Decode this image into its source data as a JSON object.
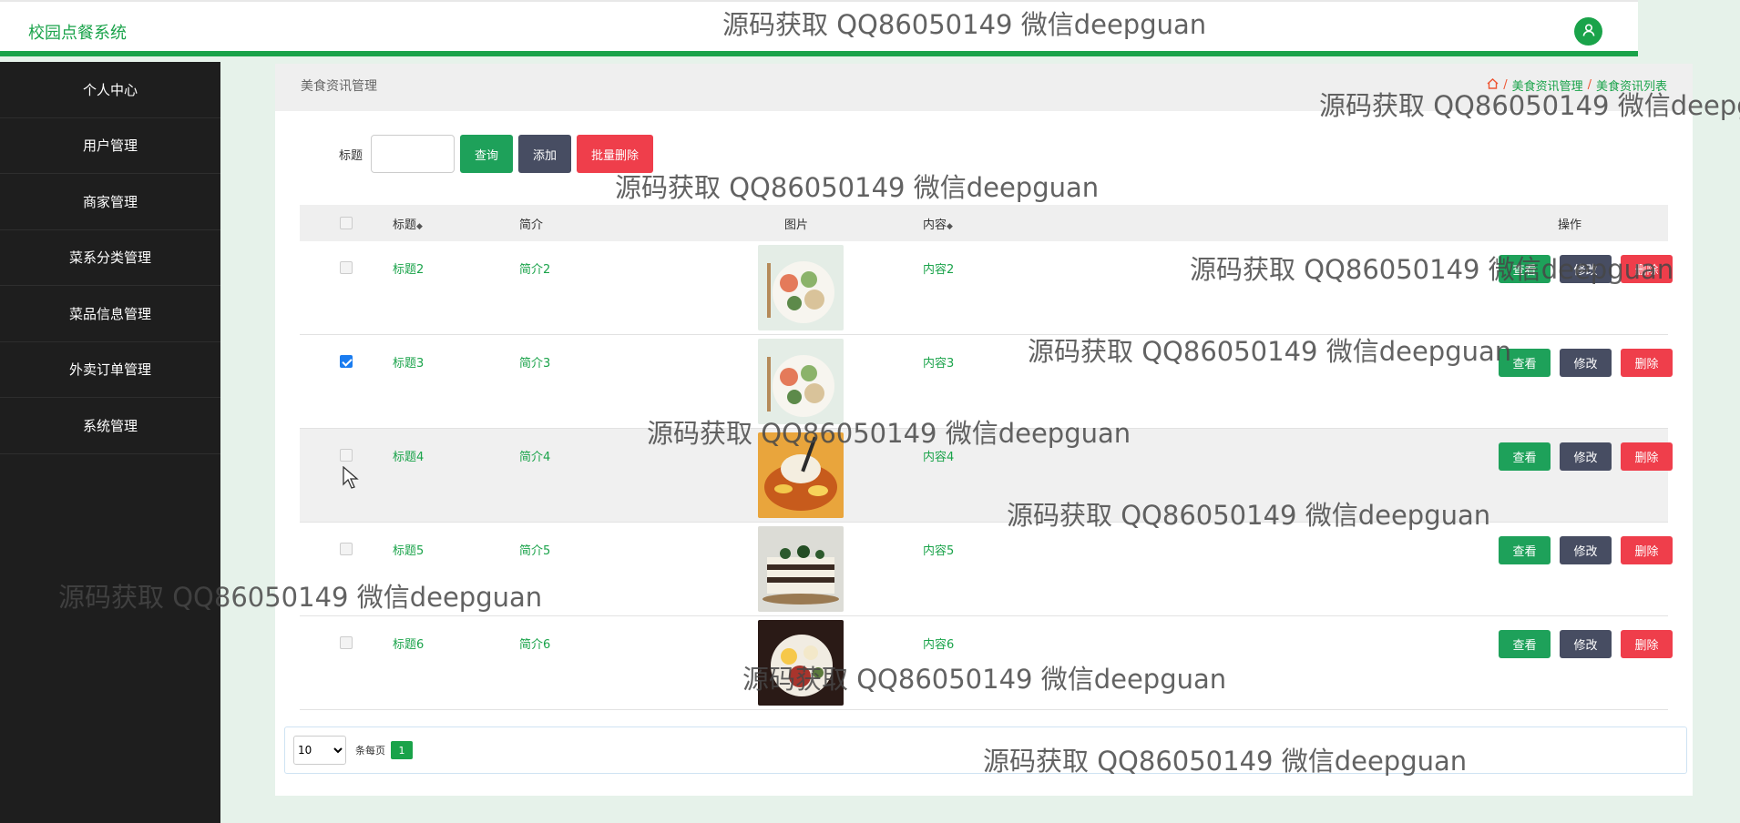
{
  "app": {
    "title": "校园点餐系统"
  },
  "sidebar": {
    "items": [
      {
        "label": "个人中心"
      },
      {
        "label": "用户管理"
      },
      {
        "label": "商家管理"
      },
      {
        "label": "菜系分类管理"
      },
      {
        "label": "菜品信息管理"
      },
      {
        "label": "外卖订单管理"
      },
      {
        "label": "系统管理"
      }
    ]
  },
  "header": {
    "title": "美食资讯管理",
    "breadcrumb": [
      "美食资讯管理",
      "美食资讯列表"
    ]
  },
  "search": {
    "label": "标题",
    "value": "",
    "query_label": "查询",
    "add_label": "添加",
    "batch_delete_label": "批量删除"
  },
  "table": {
    "columns": [
      "标题",
      "简介",
      "图片",
      "内容",
      "操作"
    ],
    "sort_icon": "◆",
    "rows": [
      {
        "title": "标题2",
        "intro": "简介2",
        "content": "内容2",
        "checked": false,
        "image": "food-plate-salad"
      },
      {
        "title": "标题3",
        "intro": "简介3",
        "content": "内容3",
        "checked": true,
        "image": "food-plate-salad"
      },
      {
        "title": "标题4",
        "intro": "简介4",
        "content": "内容4",
        "checked": false,
        "image": "food-noodle-bowl"
      },
      {
        "title": "标题5",
        "intro": "简介5",
        "content": "内容5",
        "checked": false,
        "image": "food-layer-cake"
      },
      {
        "title": "标题6",
        "intro": "简介6",
        "content": "内容6",
        "checked": false,
        "image": "food-dark-plate"
      }
    ],
    "actions": {
      "view": "查看",
      "edit": "修改",
      "delete": "删除"
    }
  },
  "pagination": {
    "page_size": "10",
    "per_page_label": "条每页",
    "current_page": "1"
  },
  "watermark": {
    "text": "源码获取 QQ86050149 微信deepguan"
  },
  "colors": {
    "accent": "#1aa34a",
    "sidebar_bg": "#1e1e1e",
    "view_button": "#1ea15a",
    "edit_button": "#474d62",
    "delete_button": "#ef3e4b"
  }
}
